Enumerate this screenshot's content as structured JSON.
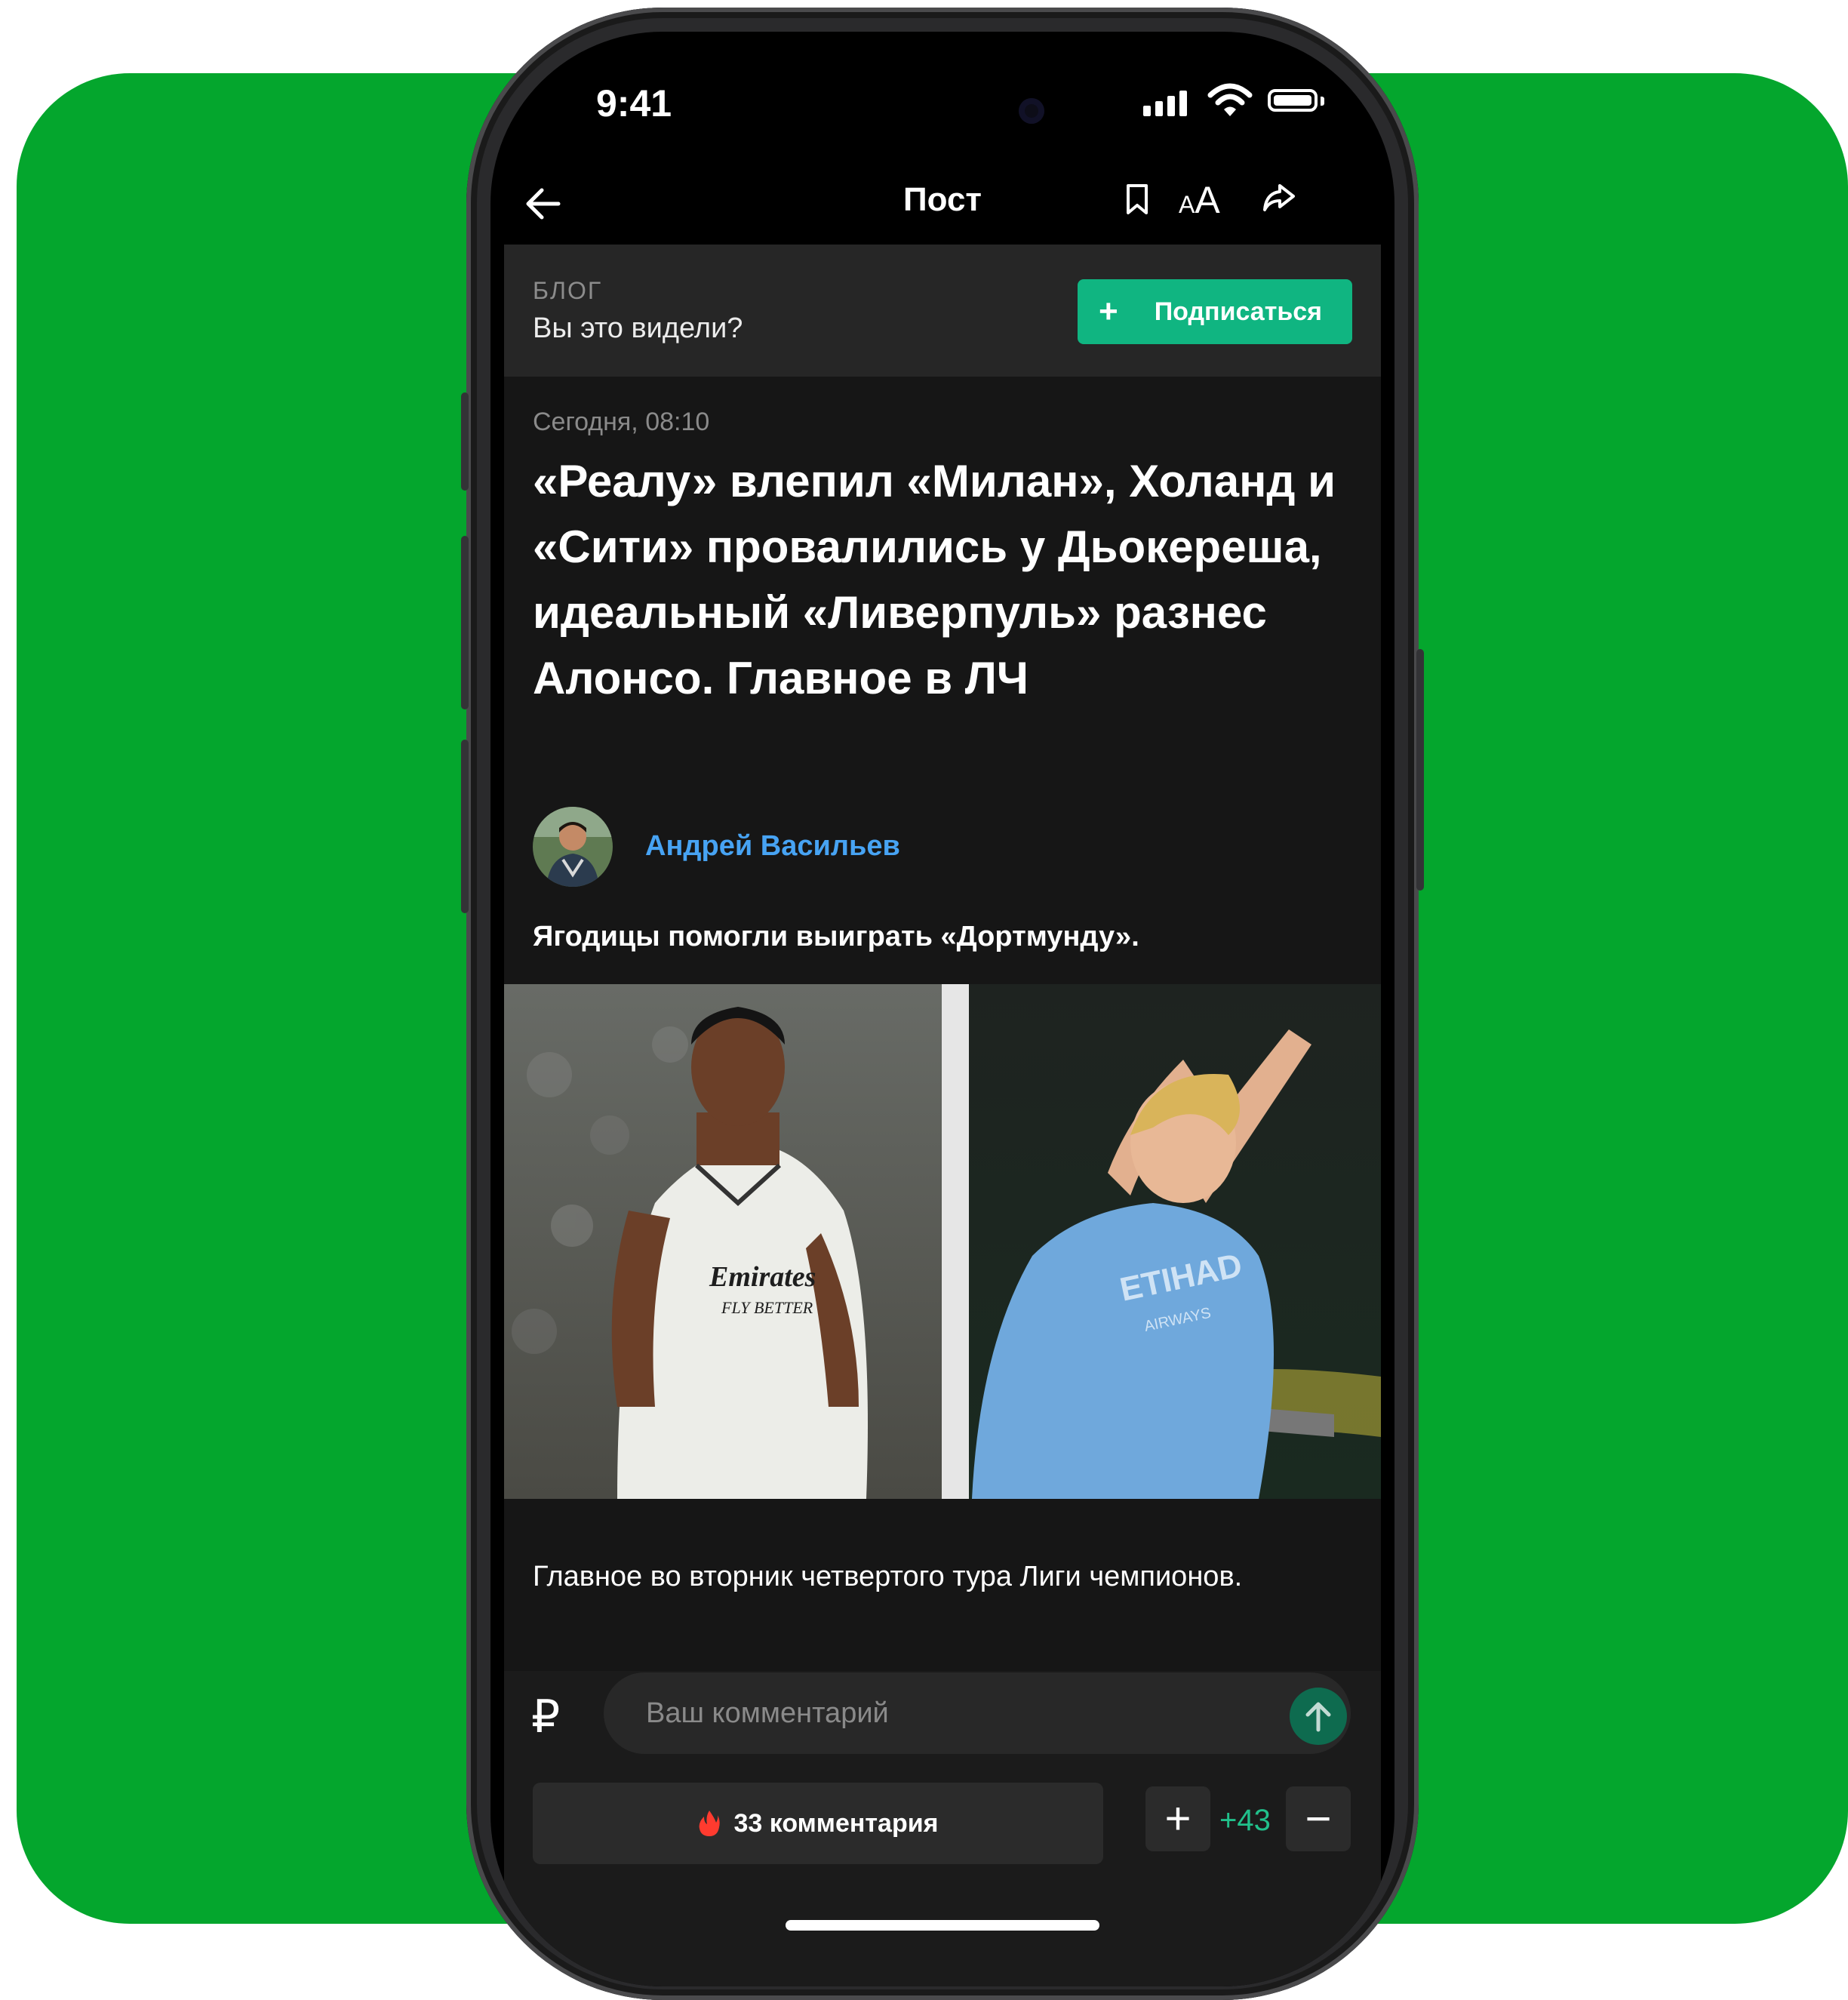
{
  "status_bar": {
    "time": "9:41"
  },
  "nav": {
    "title": "Пост",
    "font_size_icon": "AA"
  },
  "blog": {
    "label": "БЛОГ",
    "name": "Вы это видели?",
    "subscribe_label": "Подписаться"
  },
  "post": {
    "date": "Сегодня, 08:10",
    "headline": "«Реалу» влепил «Милан», Холанд и «Сити» провалились у Дьокереша, идеальный «Ливерпуль» разнес Алонсо. Главное в ЛЧ",
    "author": "Андрей Васильев",
    "lead": "Ягодицы помогли выиграть «Дортмунду».",
    "body": "Главное во вторник четвертого тура Лиги чемпионов.",
    "photo_left_sponsor": "Emirates",
    "photo_left_sponsor_sub": "FLY BETTER",
    "photo_right_sponsor": "ETIHAD",
    "photo_right_sponsor_sub": "AIRWAYS"
  },
  "comment": {
    "currency_symbol": "₽",
    "placeholder": "Ваш комментарий",
    "comments_count_label": "33 комментария",
    "plus_label": "+",
    "minus_label": "−",
    "rating": "+43"
  },
  "colors": {
    "background_card": "#04a62d",
    "accent_green": "#10b581",
    "author_link": "#47a3f3",
    "rating_green": "#21c08b",
    "fire": "#ff3b2f"
  }
}
